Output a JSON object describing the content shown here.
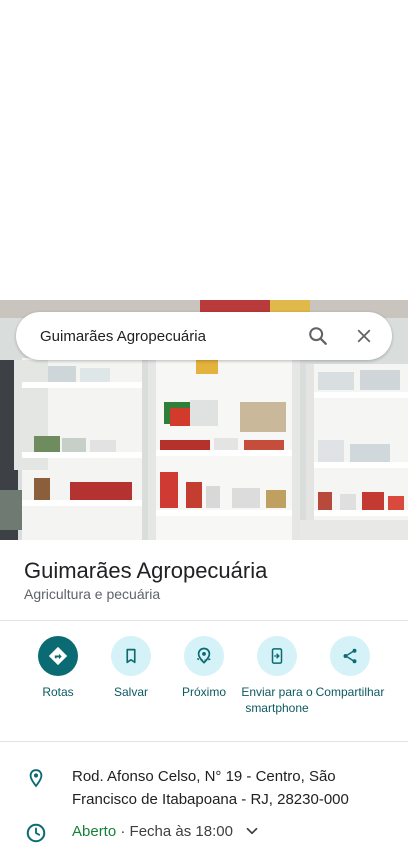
{
  "search": {
    "query": "Guimarães Agropecuária"
  },
  "place": {
    "name": "Guimarães Agropecuária",
    "category": "Agricultura e pecuária"
  },
  "actions": [
    {
      "label": "Rotas",
      "icon": "directions-icon"
    },
    {
      "label": "Salvar",
      "icon": "bookmark-icon"
    },
    {
      "label": "Próximo",
      "icon": "nearby-icon"
    },
    {
      "label": "Enviar para o smartphone",
      "icon": "send-to-phone-icon"
    },
    {
      "label": "Compartilhar",
      "icon": "share-icon"
    }
  ],
  "info": {
    "address": "Rod. Afonso Celso, N° 19 - Centro, São Francisco de Itabapoana - RJ, 28230-000",
    "hours_status": "Aberto",
    "hours_separator": "·",
    "hours_detail": "Fecha às 18:00"
  },
  "colors": {
    "accent": "#0b6b72",
    "accent_light": "#d4f2f7",
    "open_green": "#188038"
  }
}
